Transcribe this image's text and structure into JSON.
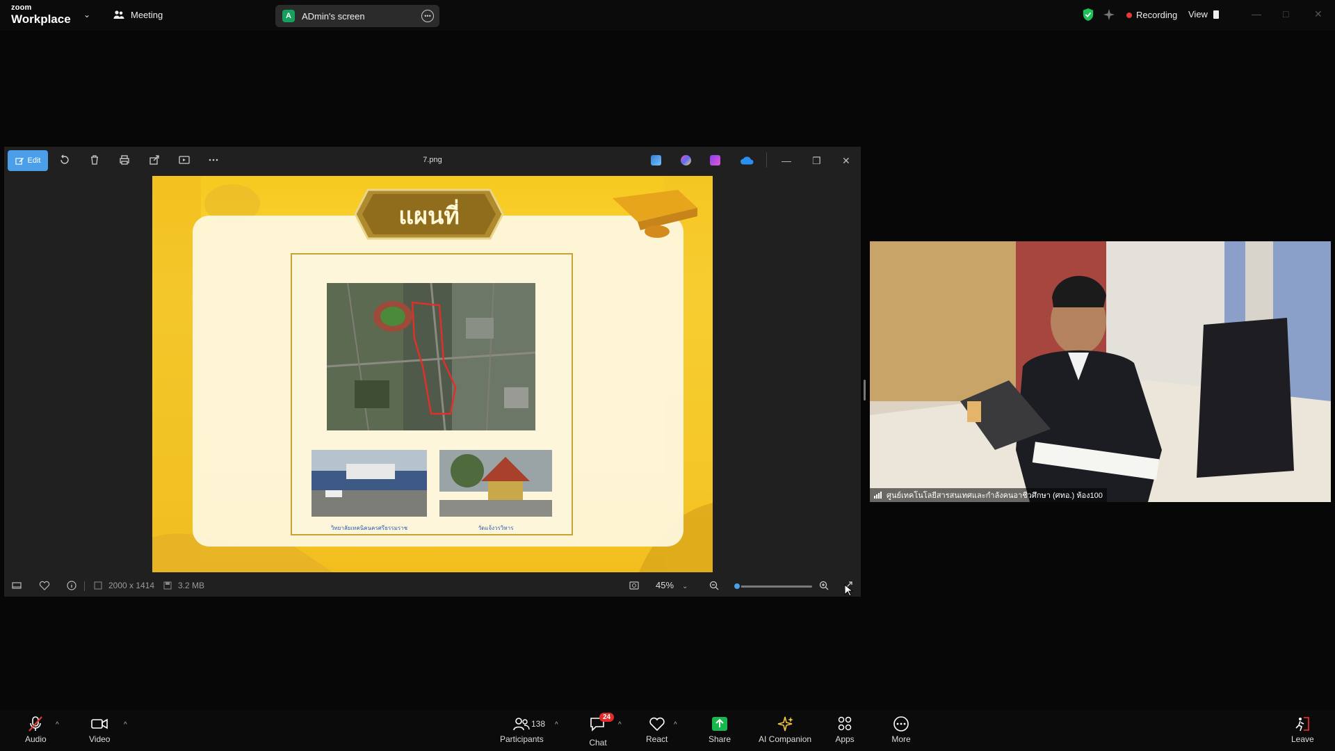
{
  "app": {
    "brand_small": "zoom",
    "brand_large": "Workplace",
    "meeting_label": "Meeting",
    "share_avatar": "A",
    "share_name": "ADmin's screen",
    "recording_label": "Recording",
    "view_label": "View"
  },
  "viewer": {
    "edit_label": "Edit",
    "filename": "7.png",
    "dimensions": "2000 x 1414",
    "filesize": "3.2 MB",
    "zoom": "45%",
    "zoom_level": 0.05,
    "slide": {
      "title": "แผนที่",
      "caption_left": "วิทยาลัยเทคนิคนครศรีธรรมราช",
      "caption_right": "วัดแจ้งวรวิหาร"
    }
  },
  "video": {
    "participant_label": "ศูนย์เทคโนโลยีสารสนเทศและกำลังคนอาชีวศึกษา (ศทอ.) ห้อง100"
  },
  "toolbar": {
    "audio": "Audio",
    "video": "Video",
    "participants": "Participants",
    "participants_count": "138",
    "chat": "Chat",
    "chat_badge": "24",
    "react": "React",
    "share": "Share",
    "ai_companion": "AI Companion",
    "apps": "Apps",
    "more": "More",
    "leave": "Leave"
  },
  "colors": {
    "accent": "#4a9fe8",
    "share_green": "#19b84f",
    "recording_red": "#e53935",
    "leave_red": "#e02b2b",
    "slide_yellow": "#f7c91f"
  }
}
